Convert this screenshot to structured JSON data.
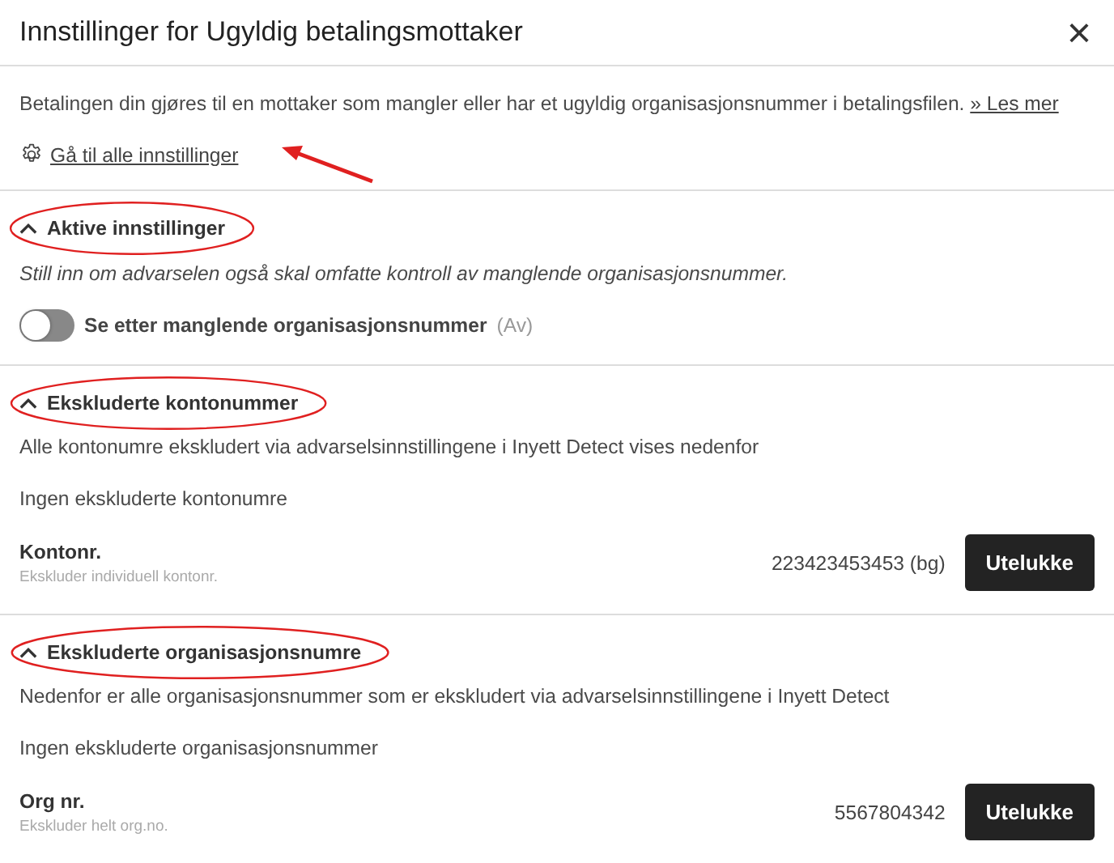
{
  "dialog": {
    "title": "Innstillinger for Ugyldig betalingsmottaker",
    "close": "×"
  },
  "intro": {
    "text": "Betalingen din gjøres til en mottaker som mangler eller har et ugyldig organisasjonsnummer i betalingsfilen.",
    "link": "» Les mer",
    "settings_link": "Gå til alle innstillinger"
  },
  "sections": [
    {
      "kind": "toggle",
      "title": "Aktive innstillinger",
      "expanded": true,
      "description": "Still inn om advarselen også skal omfatte kontroll av manglende organisasjonsnummer.",
      "toggle": {
        "label": "Se etter manglende organisasjonsnummer",
        "on": false,
        "status": "(Av)"
      }
    },
    {
      "kind": "exclusion",
      "title": "Ekskluderte kontonummer",
      "expanded": true,
      "description": "Alle kontonumre ekskludert via advarselsinnstillingene i Inyett Detect vises nedenfor",
      "empty": "Ingen ekskluderte kontonumre",
      "field": {
        "label": "Kontonr.",
        "hint": "Ekskluder individuell kontonr.",
        "value": "223423453453 (bg)",
        "button": "Utelukke"
      }
    },
    {
      "kind": "exclusion",
      "title": "Ekskluderte organisasjonsnumre",
      "expanded": true,
      "description": "Nedenfor er alle organisasjonsnummer som er ekskludert via advarselsinnstillingene i Inyett Detect",
      "empty": "Ingen ekskluderte organisasjonsnummer",
      "field": {
        "label": "Org nr.",
        "hint": "Ekskluder helt org.no.",
        "value": "5567804342",
        "button": "Utelukke"
      }
    }
  ]
}
